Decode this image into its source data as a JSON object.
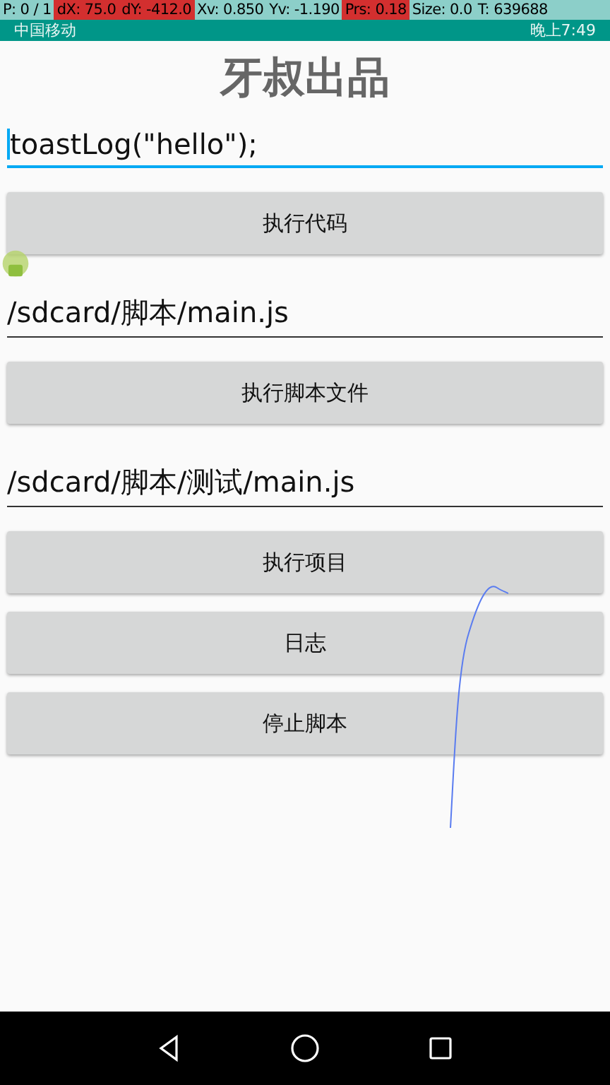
{
  "pointer_overlay": [
    {
      "text": "P: 0 / 1",
      "highlighted": false
    },
    {
      "text": "dX: 75.0",
      "highlighted": true
    },
    {
      "text": "dY: -412.0",
      "highlighted": true
    },
    {
      "text": "Xv: 0.850",
      "highlighted": false
    },
    {
      "text": "Yv: -1.190",
      "highlighted": false
    },
    {
      "text": "Prs: 0.18",
      "highlighted": true
    },
    {
      "text": "Size: 0.0",
      "highlighted": false
    },
    {
      "text": "T: 639688",
      "highlighted": false
    }
  ],
  "status_bar": {
    "carrier": "中国移动",
    "time": "晚上7:49"
  },
  "title": "牙叔出品",
  "sections": [
    {
      "kind": "field",
      "value": "toastLog(\"hello\");",
      "focused": true
    },
    {
      "kind": "button",
      "label": "执行代码"
    },
    {
      "kind": "field",
      "value": "/sdcard/脚本/main.js",
      "focused": false
    },
    {
      "kind": "button",
      "label": "执行脚本文件"
    },
    {
      "kind": "field",
      "value": "/sdcard/脚本/测试/main.js",
      "focused": false
    },
    {
      "kind": "button",
      "label": "执行项目"
    },
    {
      "kind": "button",
      "label": "日志"
    },
    {
      "kind": "button",
      "label": "停止脚本"
    }
  ]
}
